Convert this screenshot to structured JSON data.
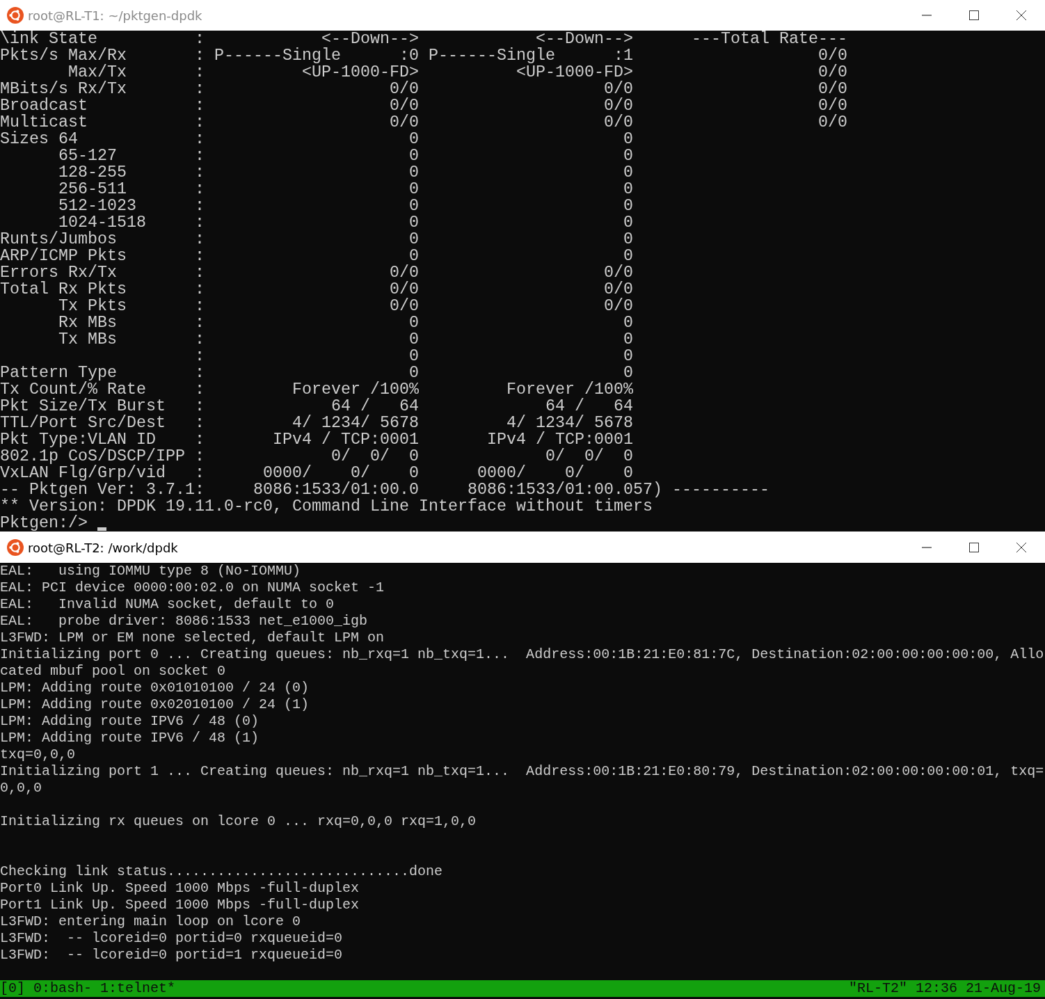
{
  "windows": [
    {
      "kind": "pktgen",
      "title": "root@RL-T1: ~/pktgen-dpdk",
      "active": false,
      "cursor": true,
      "lines": [
        {
          "kind": "text",
          "text": "\\ink State          :            <--Down-->            <--Down-->      ---Total Rate---"
        },
        {
          "kind": "text",
          "text": "Pkts/s Max/Rx       : P------Single      :0 P------Single      :1                   0/0"
        },
        {
          "kind": "text",
          "text": "       Max/Tx       :          <UP-1000-FD>          <UP-1000-FD>                   0/0"
        },
        {
          "kind": "text",
          "text": "MBits/s Rx/Tx       :                   0/0                   0/0                   0/0"
        },
        {
          "kind": "text",
          "text": "Broadcast           :                   0/0                   0/0                   0/0"
        },
        {
          "kind": "text",
          "text": "Multicast           :                   0/0                   0/0                   0/0"
        },
        {
          "kind": "text",
          "text": "Sizes 64            :                     0                     0"
        },
        {
          "kind": "text",
          "text": "      65-127        :                     0                     0"
        },
        {
          "kind": "text",
          "text": "      128-255       :                     0                     0"
        },
        {
          "kind": "text",
          "text": "      256-511       :                     0                     0"
        },
        {
          "kind": "text",
          "text": "      512-1023      :                     0                     0"
        },
        {
          "kind": "text",
          "text": "      1024-1518     :                     0                     0"
        },
        {
          "kind": "text",
          "text": "Runts/Jumbos        :                     0                     0"
        },
        {
          "kind": "text",
          "text": "ARP/ICMP Pkts       :                     0                     0"
        },
        {
          "kind": "text",
          "text": "Errors Rx/Tx        :                   0/0                   0/0"
        },
        {
          "kind": "text",
          "text": "Total Rx Pkts       :                   0/0                   0/0"
        },
        {
          "kind": "text",
          "text": "      Tx Pkts       :                   0/0                   0/0"
        },
        {
          "kind": "text",
          "text": "      Rx MBs        :                     0                     0"
        },
        {
          "kind": "text",
          "text": "      Tx MBs        :                     0                     0"
        },
        {
          "kind": "text",
          "text": "                    :                     0                     0"
        },
        {
          "kind": "text",
          "text": "Pattern Type        :                     0                     0"
        },
        {
          "kind": "text",
          "text": "Tx Count/% Rate     :         Forever /100%         Forever /100%"
        },
        {
          "kind": "text",
          "text": "Pkt Size/Tx Burst   :             64 /   64             64 /   64"
        },
        {
          "kind": "text",
          "text": "TTL/Port Src/Dest   :         4/ 1234/ 5678         4/ 1234/ 5678"
        },
        {
          "kind": "text",
          "text": "Pkt Type:VLAN ID    :       IPv4 / TCP:0001       IPv4 / TCP:0001"
        },
        {
          "kind": "text",
          "text": "802.1p CoS/DSCP/IPP :             0/  0/  0             0/  0/  0"
        },
        {
          "kind": "text",
          "text": "VxLAN Flg/Grp/vid   :      0000/    0/    0      0000/    0/    0"
        },
        {
          "kind": "text",
          "text": "-- Pktgen Ver: 3.7.1:     8086:1533/01:00.0     8086:1533/01:00.057) ----------"
        },
        {
          "kind": "text",
          "text": "** Version: DPDK 19.11.0-rc0, Command Line Interface without timers"
        },
        {
          "kind": "prompt",
          "text": "Pktgen:/>"
        }
      ]
    },
    {
      "kind": "tmux",
      "title": "root@RL-T2: /work/dpdk",
      "active": true,
      "lines": [
        {
          "kind": "text",
          "text": "EAL:   using IOMMU type 8 (No-IOMMU)"
        },
        {
          "kind": "text",
          "text": "EAL: PCI device 0000:00:02.0 on NUMA socket -1"
        },
        {
          "kind": "text",
          "text": "EAL:   Invalid NUMA socket, default to 0"
        },
        {
          "kind": "text",
          "text": "EAL:   probe driver: 8086:1533 net_e1000_igb"
        },
        {
          "kind": "text",
          "text": "L3FWD: LPM or EM none selected, default LPM on"
        },
        {
          "kind": "text",
          "text": "Initializing port 0 ... Creating queues: nb_rxq=1 nb_txq=1...  Address:00:1B:21:E0:81:7C, Destination:02:00:00:00:00:00, Allo"
        },
        {
          "kind": "text",
          "text": "cated mbuf pool on socket 0"
        },
        {
          "kind": "text",
          "text": "LPM: Adding route 0x01010100 / 24 (0)"
        },
        {
          "kind": "text",
          "text": "LPM: Adding route 0x02010100 / 24 (1)"
        },
        {
          "kind": "text",
          "text": "LPM: Adding route IPV6 / 48 (0)"
        },
        {
          "kind": "text",
          "text": "LPM: Adding route IPV6 / 48 (1)"
        },
        {
          "kind": "text",
          "text": "txq=0,0,0"
        },
        {
          "kind": "text",
          "text": "Initializing port 1 ... Creating queues: nb_rxq=1 nb_txq=1...  Address:00:1B:21:E0:80:79, Destination:02:00:00:00:00:01, txq="
        },
        {
          "kind": "text",
          "text": "0,0,0"
        },
        {
          "kind": "blank"
        },
        {
          "kind": "text",
          "text": "Initializing rx queues on lcore 0 ... rxq=0,0,0 rxq=1,0,0"
        },
        {
          "kind": "blank"
        },
        {
          "kind": "blank"
        },
        {
          "kind": "text",
          "text": "Checking link status.............................done"
        },
        {
          "kind": "text",
          "text": "Port0 Link Up. Speed 1000 Mbps -full-duplex"
        },
        {
          "kind": "text",
          "text": "Port1 Link Up. Speed 1000 Mbps -full-duplex"
        },
        {
          "kind": "text",
          "text": "L3FWD: entering main loop on lcore 0"
        },
        {
          "kind": "text",
          "text": "L3FWD:  -- lcoreid=0 portid=0 rxqueueid=0"
        },
        {
          "kind": "text",
          "text": "L3FWD:  -- lcoreid=0 portid=1 rxqueueid=0"
        },
        {
          "kind": "blank"
        }
      ],
      "status_bar": {
        "left": "[0] 0:bash- 1:telnet*",
        "right": "\"RL-T2\" 12:36 21-Aug-19"
      }
    }
  ]
}
